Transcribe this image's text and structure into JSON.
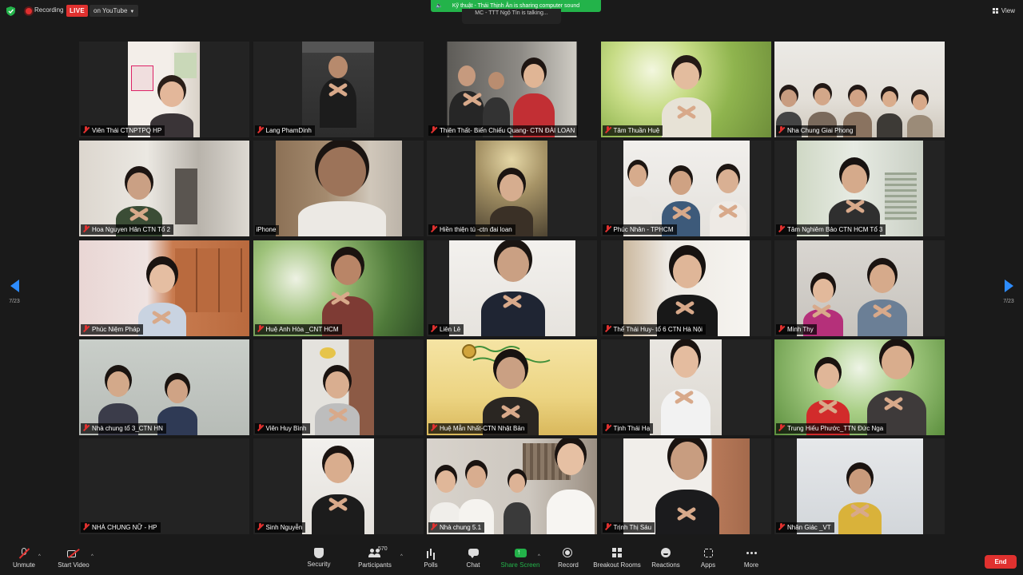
{
  "meeting": {
    "recording_label": "Recording",
    "live_label": "LIVE",
    "stream_destination": "on YouTube",
    "share_notice": "Kỹ thuật - Thái Thịnh Ân is sharing computer sound",
    "talking_notice": "MC - TTT Ngộ Tín is talking...",
    "view_label": "View",
    "page_indicator": "7/23"
  },
  "participants": [
    {
      "name": "Viên Thái CTNPTPQ HP",
      "muted": true
    },
    {
      "name": "Lang PhamDinh",
      "muted": true
    },
    {
      "name": "Thiên Thất- Biển Chiếu Quang- CTN ĐÀI LOAN",
      "muted": true
    },
    {
      "name": "Tâm Thuần Huệ",
      "muted": true
    },
    {
      "name": "Nha Chung Giai Phong",
      "muted": true
    },
    {
      "name": "Hoa Nguyen Hân CTN Tổ 2",
      "muted": true
    },
    {
      "name": "iPhone",
      "muted": false
    },
    {
      "name": "Hiền thiện tú -ctn đai loan",
      "muted": true
    },
    {
      "name": "Phúc Nhân - TPHCM",
      "muted": true
    },
    {
      "name": "Tâm Nghiêm Bảo CTN HCM Tổ 3",
      "muted": true
    },
    {
      "name": "Phúc Niệm Pháp",
      "muted": true
    },
    {
      "name": "Huệ Anh Hòa _CNT HCM",
      "muted": true
    },
    {
      "name": "Liên Lê",
      "muted": true
    },
    {
      "name": "Thể Thái Huy- tổ 6 CTN Hà Nội",
      "muted": true
    },
    {
      "name": "Minh Thy",
      "muted": true
    },
    {
      "name": "Nhà chung tổ 3_CTN HN",
      "muted": true
    },
    {
      "name": "Viên Huy Bình",
      "muted": true
    },
    {
      "name": "Huệ Mẫn Nhất-CTN Nhật Bản",
      "muted": true
    },
    {
      "name": "Tịnh Thái Hạ",
      "muted": true
    },
    {
      "name": "Trung Hiếu Phước_TTN Đức Nga",
      "muted": true
    },
    {
      "name": "NHÀ CHUNG NỮ - HP",
      "muted": true
    },
    {
      "name": "Sinh Nguyễn",
      "muted": true
    },
    {
      "name": "Nhà chung 5.1",
      "muted": true
    },
    {
      "name": "Trịnh Thị Sáu",
      "muted": true
    },
    {
      "name": "Nhân Giác _VT",
      "muted": true
    }
  ],
  "toolbar": {
    "unmute": "Unmute",
    "start_video": "Start Video",
    "security": "Security",
    "participants": "Participants",
    "participant_count": "570",
    "polls": "Polls",
    "chat": "Chat",
    "share_screen": "Share Screen",
    "record": "Record",
    "breakout_rooms": "Breakout Rooms",
    "reactions": "Reactions",
    "apps": "Apps",
    "more": "More",
    "end": "End"
  },
  "colors": {
    "accent_blue": "#2d8cff",
    "share_green": "#23b34a",
    "live_red": "#e0312f",
    "background": "#1a1a1a"
  }
}
